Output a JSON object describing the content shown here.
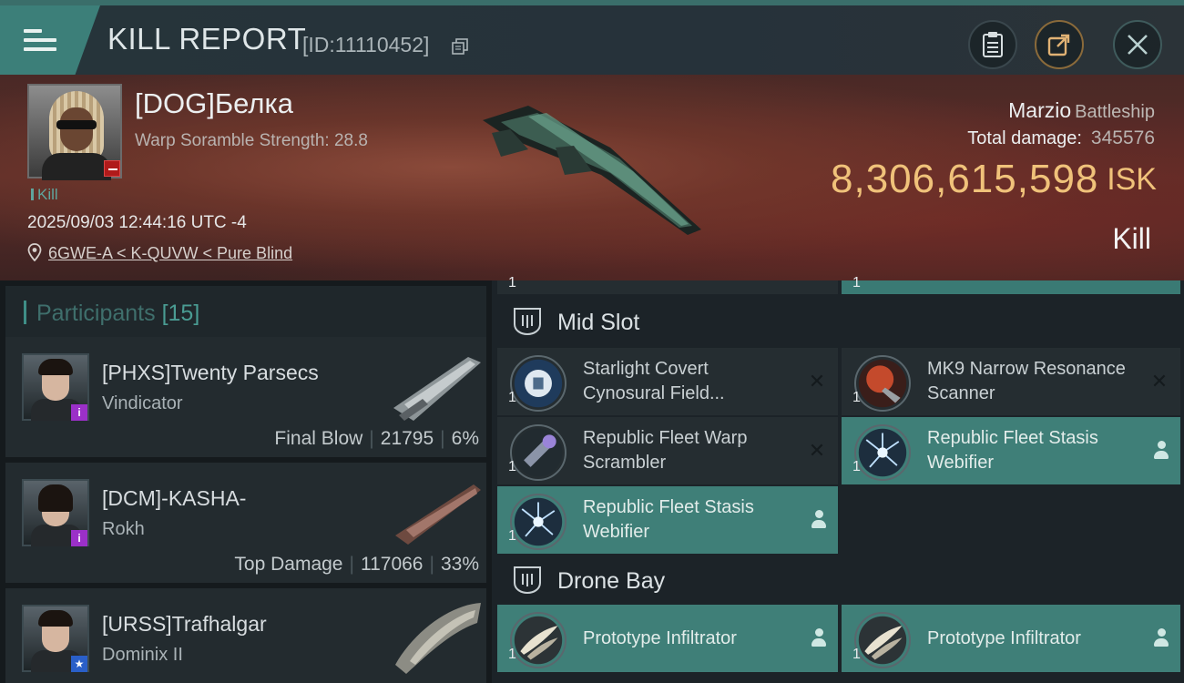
{
  "header": {
    "title": "KILL REPORT",
    "report_id": "[ID:11110452]"
  },
  "victim": {
    "pilot": "[DOG]Белка",
    "scramble": "Warp Soramble Strength: 28.8",
    "tag": "Kill",
    "datetime": "2025/09/03 12:44:16 UTC -4",
    "location": "6GWE-A < K-QUVW < Pure Blind",
    "ship_name": "Marzio",
    "ship_class": "Battleship",
    "total_damage_label": "Total damage:",
    "total_damage": "345576",
    "isk_value": "8,306,615,598",
    "isk_unit": "ISK",
    "result": "Kill"
  },
  "participants": {
    "label": "Participants",
    "count": "[15]",
    "items": [
      {
        "name": "[PHXS]Twenty Parsecs",
        "ship": "Vindicator",
        "role": "Final Blow",
        "damage": "21795",
        "percent": "6%",
        "badge": "i"
      },
      {
        "name": "[DCM]-KASHA-",
        "ship": "Rokh",
        "role": "Top Damage",
        "damage": "117066",
        "percent": "33%",
        "badge": "i"
      },
      {
        "name": "[URSS]Trafhalgar",
        "ship": "Dominix II",
        "role": "",
        "damage": "",
        "percent": "",
        "badge": "★"
      }
    ]
  },
  "fitting": {
    "partial_qty_left": "1",
    "partial_qty_right": "1",
    "mid_slot": {
      "label": "Mid Slot",
      "modules": [
        {
          "qty": "1",
          "name": "Starlight Covert Cynosural Field...",
          "status": "destroyed"
        },
        {
          "qty": "1",
          "name": "MK9 Narrow Resonance Scanner",
          "status": "destroyed"
        },
        {
          "qty": "1",
          "name": "Republic Fleet Warp Scrambler",
          "status": "destroyed"
        },
        {
          "qty": "1",
          "name": "Republic Fleet Stasis Webifier",
          "status": "dropped"
        },
        {
          "qty": "1",
          "name": "Republic Fleet Stasis Webifier",
          "status": "dropped"
        }
      ]
    },
    "drone_bay": {
      "label": "Drone Bay",
      "modules": [
        {
          "qty": "1",
          "name": "Prototype  Infiltrator",
          "status": "dropped"
        },
        {
          "qty": "1",
          "name": "Prototype  Infiltrator",
          "status": "dropped"
        }
      ]
    },
    "destroyed_glyph": "✕"
  },
  "colors": {
    "accent": "#3f7f78",
    "isk": "#f0c27a",
    "hero_bg": "#5b2c28",
    "panel_bg": "#232b2f"
  }
}
